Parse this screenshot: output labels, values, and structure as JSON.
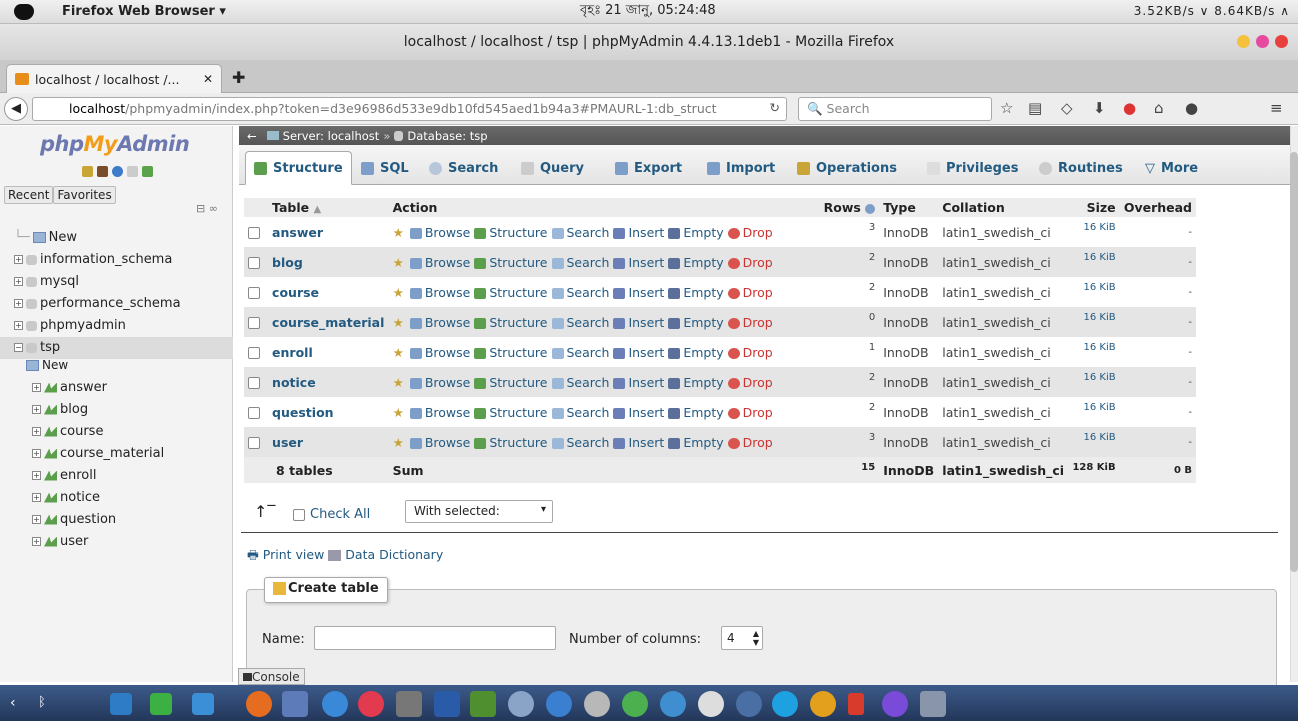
{
  "system_bar": {
    "app_name": "Firefox Web Browser ▾",
    "clock": "বৃহঃ 21 জানু, 05:24:48",
    "net_status": "3.52KB/s ∨ 8.64KB/s ∧"
  },
  "window": {
    "title": "localhost / localhost / tsp | phpMyAdmin 4.4.13.1deb1 - Mozilla Firefox"
  },
  "browser": {
    "tab_label": "localhost / localhost /...",
    "url_host": "localhost",
    "url_rest": "/phpmyadmin/index.php?token=d3e96986d533e9db10fd545aed1b94a3#PMAURL-1:db_struct",
    "search_placeholder": "Search"
  },
  "sidebar": {
    "logo_php": "php",
    "logo_my": "My",
    "logo_admin": "Admin",
    "recent": "Recent",
    "favorites": "Favorites",
    "databases": [
      "New",
      "information_schema",
      "mysql",
      "performance_schema",
      "phpmyadmin",
      "tsp"
    ],
    "tsp_children": [
      "New",
      "answer",
      "blog",
      "course",
      "course_material",
      "enroll",
      "notice",
      "question",
      "user"
    ]
  },
  "breadcrumb": {
    "server": "Server: localhost",
    "database": "Database: tsp"
  },
  "tabs": [
    "Structure",
    "SQL",
    "Search",
    "Query",
    "Export",
    "Import",
    "Operations",
    "Privileges",
    "Routines",
    "More"
  ],
  "table_headers": {
    "table": "Table",
    "action": "Action",
    "rows": "Rows",
    "type": "Type",
    "collation": "Collation",
    "size": "Size",
    "overhead": "Overhead"
  },
  "actions": [
    "Browse",
    "Structure",
    "Search",
    "Insert",
    "Empty",
    "Drop"
  ],
  "rows": [
    {
      "name": "answer",
      "rows": "3",
      "type": "InnoDB",
      "collation": "latin1_swedish_ci",
      "size": "16 KiB",
      "overhead": "-"
    },
    {
      "name": "blog",
      "rows": "2",
      "type": "InnoDB",
      "collation": "latin1_swedish_ci",
      "size": "16 KiB",
      "overhead": "-"
    },
    {
      "name": "course",
      "rows": "2",
      "type": "InnoDB",
      "collation": "latin1_swedish_ci",
      "size": "16 KiB",
      "overhead": "-"
    },
    {
      "name": "course_material",
      "rows": "0",
      "type": "InnoDB",
      "collation": "latin1_swedish_ci",
      "size": "16 KiB",
      "overhead": "-"
    },
    {
      "name": "enroll",
      "rows": "1",
      "type": "InnoDB",
      "collation": "latin1_swedish_ci",
      "size": "16 KiB",
      "overhead": "-"
    },
    {
      "name": "notice",
      "rows": "2",
      "type": "InnoDB",
      "collation": "latin1_swedish_ci",
      "size": "16 KiB",
      "overhead": "-"
    },
    {
      "name": "question",
      "rows": "2",
      "type": "InnoDB",
      "collation": "latin1_swedish_ci",
      "size": "16 KiB",
      "overhead": "-"
    },
    {
      "name": "user",
      "rows": "3",
      "type": "InnoDB",
      "collation": "latin1_swedish_ci",
      "size": "16 KiB",
      "overhead": "-"
    }
  ],
  "summary": {
    "tables": "8 tables",
    "label": "Sum",
    "rows": "15",
    "type": "InnoDB",
    "collation": "latin1_swedish_ci",
    "size": "128 KiB",
    "overhead": "0 B"
  },
  "bulk": {
    "check_all": "Check All",
    "with_selected": "With selected:"
  },
  "links": {
    "print_view": "Print view",
    "data_dictionary": "Data Dictionary"
  },
  "create_table": {
    "legend": "Create table",
    "name_label": "Name:",
    "cols_label": "Number of columns:",
    "cols_value": "4"
  },
  "console_label": "Console"
}
